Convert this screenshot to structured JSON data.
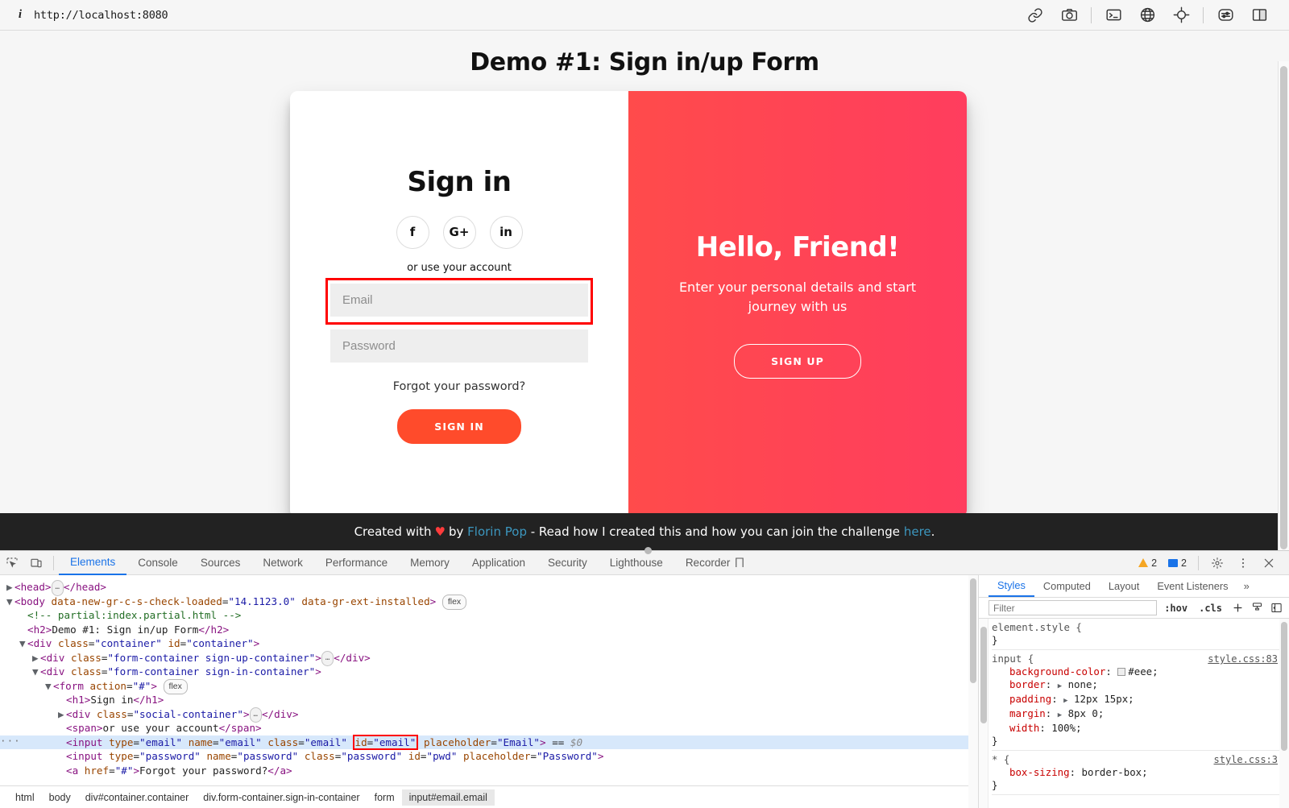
{
  "browser": {
    "info_icon": "i",
    "url": "http://localhost:8080",
    "icons": [
      {
        "name": "link-icon",
        "glyph": "link"
      },
      {
        "name": "camera-icon",
        "glyph": "camera"
      },
      {
        "name": "terminal-icon",
        "glyph": "terminal"
      },
      {
        "name": "globe-icon",
        "glyph": "globe"
      },
      {
        "name": "crosshair-icon",
        "glyph": "crosshair"
      },
      {
        "name": "sliders-icon",
        "glyph": "sliders"
      },
      {
        "name": "split-panel-icon",
        "glyph": "split"
      }
    ]
  },
  "page": {
    "title": "Demo #1: Sign in/up Form",
    "signin": {
      "heading": "Sign in",
      "social": [
        {
          "name": "facebook-link",
          "label": "f"
        },
        {
          "name": "google-plus-link",
          "label": "G+"
        },
        {
          "name": "linkedin-link",
          "label": "in"
        }
      ],
      "or_text": "or use your account",
      "email_placeholder": "Email",
      "email_value": "",
      "password_placeholder": "Password",
      "password_value": "",
      "forgot_label": "Forgot your password?",
      "submit_label": "Sign In"
    },
    "overlay": {
      "heading": "Hello, Friend!",
      "text": "Enter your personal details and start journey with us",
      "button_label": "Sign Up",
      "gradient_from": "#FF4B4B",
      "gradient_to": "#FF3D5E"
    },
    "footer": {
      "created_with": "Created with",
      "heart": "♥",
      "by": "by",
      "author": "Florin Pop",
      "middle": "- Read how I created this and how you can join the challenge",
      "here": "here",
      "period": "."
    },
    "highlight_color": "#ff0000"
  },
  "devtools": {
    "tabs": [
      {
        "label": "Elements",
        "active": true
      },
      {
        "label": "Console",
        "active": false
      },
      {
        "label": "Sources",
        "active": false
      },
      {
        "label": "Network",
        "active": false
      },
      {
        "label": "Performance",
        "active": false
      },
      {
        "label": "Memory",
        "active": false
      },
      {
        "label": "Application",
        "active": false
      },
      {
        "label": "Security",
        "active": false
      },
      {
        "label": "Lighthouse",
        "active": false
      },
      {
        "label": "Recorder",
        "active": false
      }
    ],
    "recorder_glyph": "⨅",
    "warnings_count": "2",
    "messages_count": "2",
    "settings_icon": "gear",
    "more_icon": "kebab",
    "close_icon": "close",
    "dom": {
      "lines": [
        {
          "indent": 0,
          "tri": "▶",
          "html": "<span class='tag'>&lt;head&gt;</span><span class='ellipsis-dots'>…</span><span class='tag'>&lt;/head&gt;</span>"
        },
        {
          "indent": 0,
          "tri": "▼",
          "html": "<span class='tag'>&lt;body</span> <span class='attr'>data-new-gr-c-s-check-loaded</span>=<span class='val'>\"14.1123.0\"</span> <span class='attr'>data-gr-ext-installed</span><span class='tag'>&gt;</span> <span class='badge-flex'>flex</span>"
        },
        {
          "indent": 1,
          "tri": "",
          "html": "<span class='comment'>&lt;!-- partial:index.partial.html --&gt;</span>"
        },
        {
          "indent": 1,
          "tri": "",
          "html": "<span class='tag'>&lt;h2&gt;</span><span class='txt'>Demo #1: Sign in/up Form</span><span class='tag'>&lt;/h2&gt;</span>"
        },
        {
          "indent": 1,
          "tri": "▼",
          "html": "<span class='tag'>&lt;div</span> <span class='attr'>class</span>=<span class='val'>\"container\"</span> <span class='attr'>id</span>=<span class='val'>\"container\"</span><span class='tag'>&gt;</span>"
        },
        {
          "indent": 2,
          "tri": "▶",
          "html": "<span class='tag'>&lt;div</span> <span class='attr'>class</span>=<span class='val'>\"form-container sign-up-container\"</span><span class='tag'>&gt;</span><span class='ellipsis-dots'>…</span><span class='tag'>&lt;/div&gt;</span>"
        },
        {
          "indent": 2,
          "tri": "▼",
          "html": "<span class='tag'>&lt;div</span> <span class='attr'>class</span>=<span class='val'>\"form-container sign-in-container\"</span><span class='tag'>&gt;</span>"
        },
        {
          "indent": 3,
          "tri": "▼",
          "html": "<span class='tag'>&lt;form</span> <span class='attr'>action</span>=<span class='val'>\"#\"</span><span class='tag'>&gt;</span> <span class='badge-flex'>flex</span>"
        },
        {
          "indent": 4,
          "tri": "",
          "html": "<span class='tag'>&lt;h1&gt;</span><span class='txt'>Sign in</span><span class='tag'>&lt;/h1&gt;</span>"
        },
        {
          "indent": 4,
          "tri": "▶",
          "html": "<span class='tag'>&lt;div</span> <span class='attr'>class</span>=<span class='val'>\"social-container\"</span><span class='tag'>&gt;</span><span class='ellipsis-dots'>…</span><span class='tag'>&lt;/div&gt;</span>"
        },
        {
          "indent": 4,
          "tri": "",
          "html": "<span class='tag'>&lt;span&gt;</span><span class='txt'>or use your account</span><span class='tag'>&lt;/span&gt;</span>"
        },
        {
          "indent": 4,
          "tri": "",
          "selected": true,
          "html": "<span class='tag'>&lt;input</span> <span class='attr'>type</span>=<span class='val'>\"email\"</span> <span class='attr'>name</span>=<span class='val'>\"email\"</span> <span class='attr'>class</span>=<span class='val'>\"email\"</span> <span class='red-box'><span class='attr'>id</span>=<span class='val'>\"email\"</span></span> <span class='attr'>placeholder</span>=<span class='val'>\"Email\"</span><span class='tag'>&gt;</span> == <span class='sel-marker'>$0</span>"
        },
        {
          "indent": 4,
          "tri": "",
          "html": "<span class='tag'>&lt;input</span> <span class='attr'>type</span>=<span class='val'>\"password\"</span> <span class='attr'>name</span>=<span class='val'>\"password\"</span> <span class='attr'>class</span>=<span class='val'>\"password\"</span> <span class='attr'>id</span>=<span class='val'>\"pwd\"</span> <span class='attr'>placeholder</span>=<span class='val'>\"Password\"</span><span class='tag'>&gt;</span>"
        },
        {
          "indent": 4,
          "tri": "",
          "html": "<span class='tag'>&lt;a</span> <span class='attr'>href</span>=<span class='val'>\"#\"</span><span class='tag'>&gt;</span><span class='txt'>Forgot your password?</span><span class='tag'>&lt;/a&gt;</span>"
        }
      ]
    },
    "breadcrumb": [
      {
        "label": "html",
        "active": false
      },
      {
        "label": "body",
        "active": false
      },
      {
        "label": "div#container.container",
        "active": false
      },
      {
        "label": "div.form-container.sign-in-container",
        "active": false
      },
      {
        "label": "form",
        "active": false
      },
      {
        "label": "input#email.email",
        "active": true
      }
    ],
    "styles": {
      "tabs": [
        {
          "label": "Styles",
          "active": true
        },
        {
          "label": "Computed",
          "active": false
        },
        {
          "label": "Layout",
          "active": false
        },
        {
          "label": "Event Listeners",
          "active": false
        }
      ],
      "more_label": "»",
      "filter_placeholder": "Filter",
      "hov_label": ":hov",
      "cls_label": ".cls",
      "plus_label": "+",
      "rules": [
        {
          "selector": "element.style {",
          "source": "",
          "declarations": [],
          "close": "}"
        },
        {
          "selector": "input {",
          "source": "style.css:83",
          "declarations": [
            {
              "prop": "background-color",
              "value": "#eee",
              "swatch": "#eeeeee",
              "expandable": false
            },
            {
              "prop": "border",
              "value": "none",
              "swatch": null,
              "expandable": true
            },
            {
              "prop": "padding",
              "value": "12px 15px",
              "swatch": null,
              "expandable": true
            },
            {
              "prop": "margin",
              "value": "8px 0",
              "swatch": null,
              "expandable": true
            },
            {
              "prop": "width",
              "value": "100%",
              "swatch": null,
              "expandable": false
            }
          ],
          "close": "}"
        },
        {
          "selector": "* {",
          "source": "style.css:3",
          "declarations": [
            {
              "prop": "box-sizing",
              "value": "border-box",
              "swatch": null,
              "expandable": false
            }
          ],
          "close": "}"
        }
      ]
    }
  }
}
